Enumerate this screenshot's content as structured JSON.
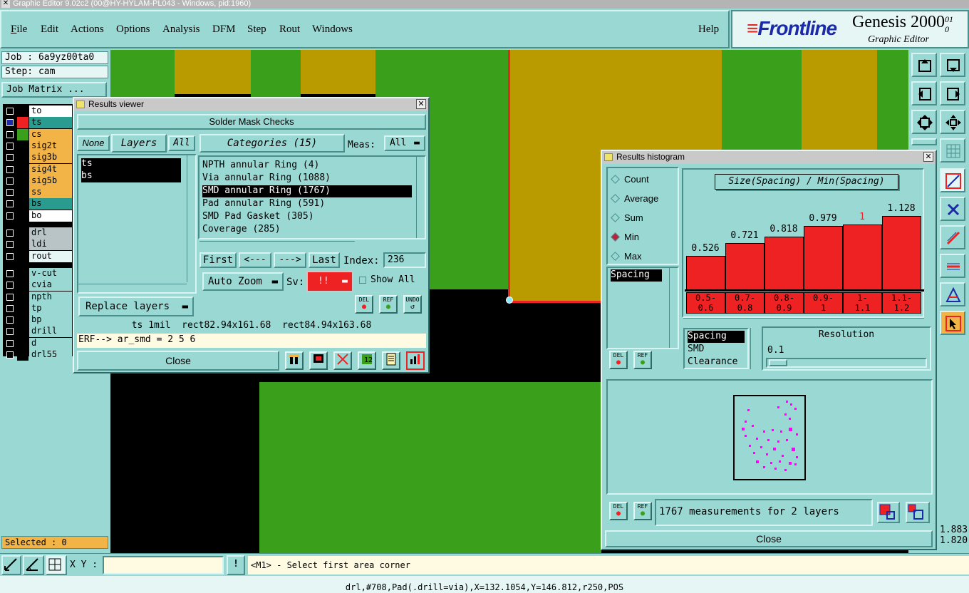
{
  "window_title": "Graphic Editor 9.02c2 (00@HY-HYLAM-PL043 - Windows, pid:1960)",
  "menu": {
    "file": "File",
    "edit": "Edit",
    "actions": "Actions",
    "options": "Options",
    "analysis": "Analysis",
    "dfm": "DFM",
    "step": "Step",
    "rout": "Rout",
    "windows": "Windows",
    "help": "Help"
  },
  "logo": {
    "brand": "Frontline",
    "product": "Genesis 2000",
    "subtitle": "Graphic Editor",
    "rev1": "01",
    "rev2": "0"
  },
  "job": {
    "job_label": "Job : 6a9yz00ta0",
    "step_label": "Step: cam",
    "matrix_button": "Job Matrix ..."
  },
  "layers": [
    {
      "name": "to",
      "swatch": "#000000",
      "bg": "#ffffff"
    },
    {
      "name": "ts",
      "swatch": "#ee2222",
      "bg": "#2a9b8f",
      "checked": true
    },
    {
      "name": "cs",
      "swatch": "#3a9f1a",
      "bg": "#f2b347"
    },
    {
      "name": "sig2t",
      "swatch": "#000000",
      "bg": "#f2b347"
    },
    {
      "name": "sig3b",
      "swatch": "#000000",
      "bg": "#f2b347"
    },
    {
      "name": "sig4t",
      "swatch": "#000000",
      "bg": "#f2b347"
    },
    {
      "name": "sig5b",
      "swatch": "#000000",
      "bg": "#f2b347"
    },
    {
      "name": "ss",
      "swatch": "#000000",
      "bg": "#f2b347"
    },
    {
      "name": "bs",
      "swatch": "#000000",
      "bg": "#2a9b8f"
    },
    {
      "name": "bo",
      "swatch": "#000000",
      "bg": "#ffffff"
    },
    {
      "name": "drl",
      "swatch": "#000000",
      "bg": "#b8c4c6"
    },
    {
      "name": "ldi",
      "swatch": "#000000",
      "bg": "#b8c4c6"
    },
    {
      "name": "rout",
      "swatch": "#000000",
      "bg": "#e6f6f5"
    },
    {
      "name": "v-cut",
      "swatch": "#000000",
      "bg": "#9ad8d4"
    },
    {
      "name": "cvia",
      "swatch": "#000000",
      "bg": "#9ad8d4"
    },
    {
      "name": "npth",
      "swatch": "#000000",
      "bg": "#9ad8d4"
    },
    {
      "name": "tp",
      "swatch": "#000000",
      "bg": "#9ad8d4"
    },
    {
      "name": "bp",
      "swatch": "#000000",
      "bg": "#9ad8d4"
    },
    {
      "name": "drill",
      "swatch": "#000000",
      "bg": "#9ad8d4"
    },
    {
      "name": "d",
      "swatch": "#000000",
      "bg": "#9ad8d4"
    },
    {
      "name": "drl55",
      "swatch": "#000000",
      "bg": "#9ad8d4"
    }
  ],
  "selected_label": "Selected : 0",
  "results_viewer": {
    "title": "Results viewer",
    "header": "Solder Mask Checks",
    "none_btn": "None",
    "layers_btn": "Layers",
    "all_btn": "All",
    "categories_btn": "Categories (15)",
    "meas_label": "Meas:",
    "meas_value": "All",
    "layer_list": [
      "ts",
      "bs"
    ],
    "categories": [
      "NPTH annular Ring (4)",
      "Via annular Ring (1088)",
      "SMD annular Ring (1767)",
      "Pad annular Ring (591)",
      "SMD Pad Gasket (305)",
      "Coverage (285)"
    ],
    "first_btn": "First",
    "prev_btn": "<---",
    "next_btn": "--->",
    "last_btn": "Last",
    "index_label": "Index:",
    "index_value": "236",
    "autozoom": "Auto Zoom",
    "sv_label": "Sv:",
    "sv_value": "!!",
    "show_all": "Show All",
    "replace_layers": "Replace layers",
    "del": "DEL",
    "ref": "REF",
    "undo": "UNDO",
    "info_line": "ts 1mil  rect82.94x161.68  rect84.94x163.68",
    "erf_line": "ERF--> ar_smd = 2 5 6",
    "close": "Close"
  },
  "histogram": {
    "title": "Results histogram",
    "modes": [
      "Count",
      "Average",
      "Sum",
      "Min",
      "Max"
    ],
    "active_mode": "Min",
    "measure_list": [
      "Spacing"
    ],
    "chart_title": "Size(Spacing) / Min(Spacing)",
    "bin_labels": [
      [
        "0.5-",
        "0.6"
      ],
      [
        "0.7-",
        "0.8"
      ],
      [
        "0.8-",
        "0.9"
      ],
      [
        "0.9-",
        "1"
      ],
      [
        "1-",
        "1.1"
      ],
      [
        "1.1-",
        "1.2"
      ]
    ],
    "bin_values": [
      0.526,
      0.721,
      0.818,
      0.979,
      1,
      1.128
    ],
    "value_labels": [
      "0.526",
      "0.721",
      "0.818",
      "0.979",
      "1",
      "1.128"
    ],
    "highlight_index": 4,
    "type_list": [
      "Spacing",
      "SMD",
      "Clearance"
    ],
    "resolution_label": "Resolution",
    "resolution_value": "0.1",
    "del": "DEL",
    "ref": "REF",
    "measurements": "1767 measurements for 2 layers",
    "close": "Close"
  },
  "right_coords": [
    "1.883",
    "1.820"
  ],
  "bottom": {
    "xy_label": "X Y :",
    "xy_value": "",
    "prompt": "<M1> - Select first area corner",
    "status": "drl,#708,Pad(.drill=via),X=132.1054,Y=146.812,r250,POS"
  },
  "colors": {
    "panel": "#9ad8d4",
    "green": "#3a9f1a",
    "gold": "#b99b00",
    "red": "#ee2222",
    "magenta": "#ff00ff"
  }
}
